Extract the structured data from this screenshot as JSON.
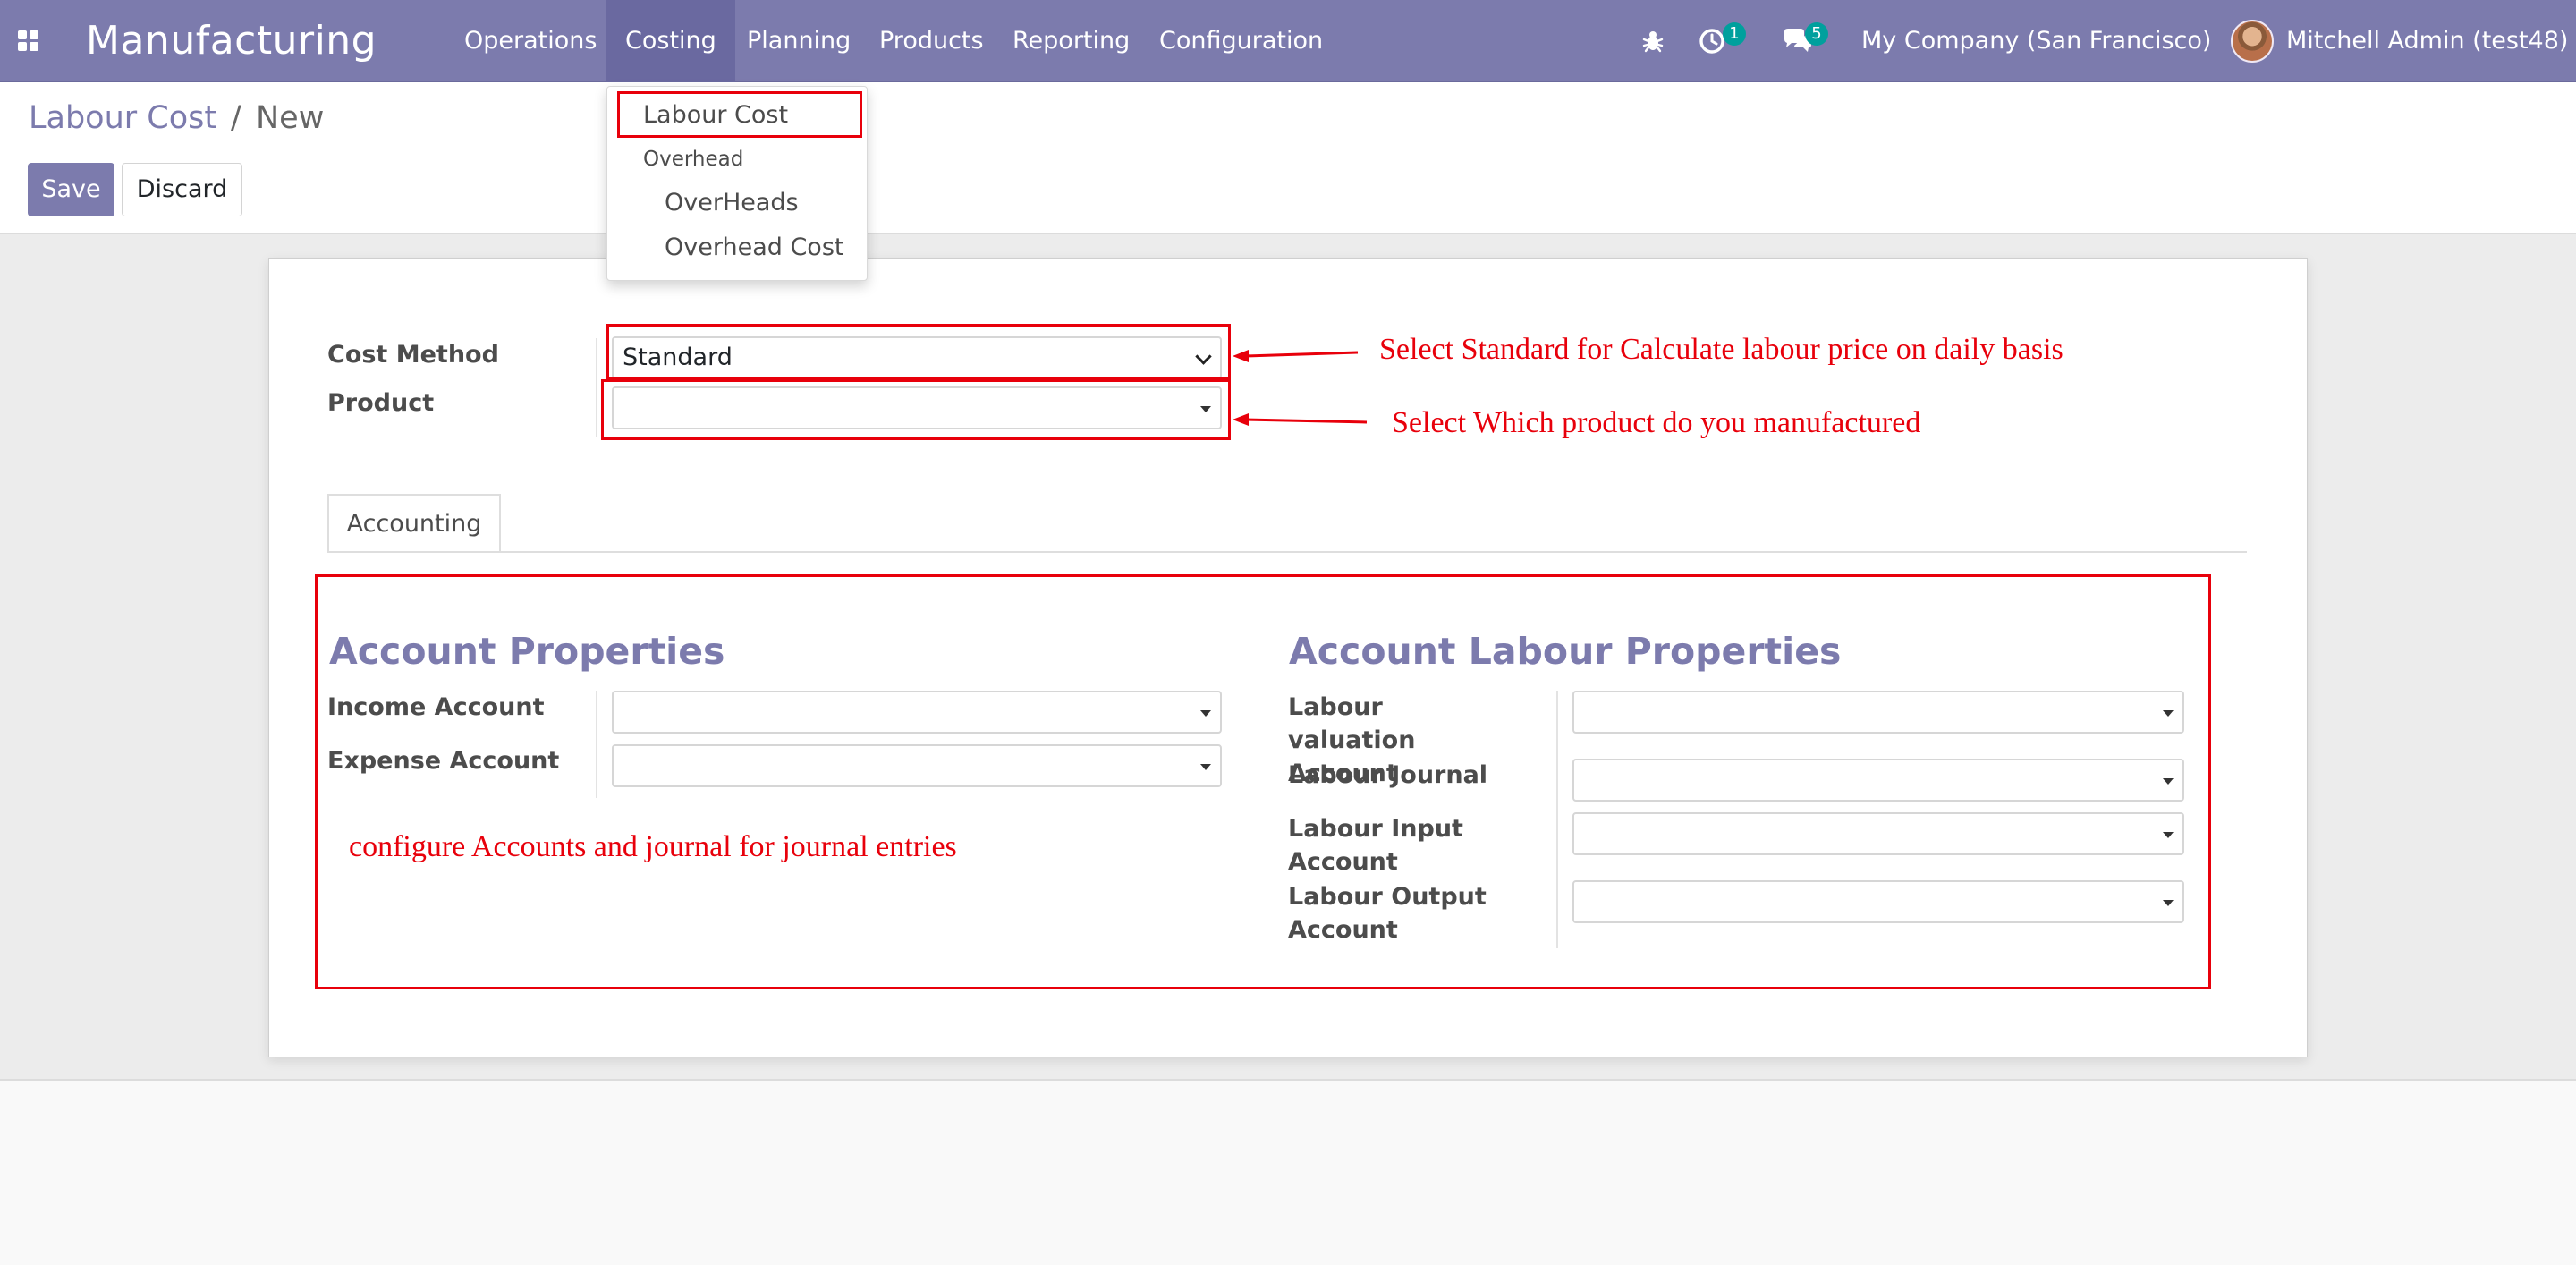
{
  "navbar": {
    "app_name": "Manufacturing",
    "menus": [
      "Operations",
      "Costing",
      "Planning",
      "Products",
      "Reporting",
      "Configuration"
    ],
    "active_menu": "Costing",
    "activity_count": "1",
    "message_count": "5",
    "company": "My Company (San Francisco)",
    "user": "Mitchell Admin (test48)"
  },
  "dropdown": {
    "items": [
      {
        "label": "Labour Cost",
        "type": "item",
        "highlighted": true
      },
      {
        "label": "Overhead",
        "type": "header"
      },
      {
        "label": "OverHeads",
        "type": "item"
      },
      {
        "label": "Overhead Cost",
        "type": "item"
      }
    ]
  },
  "breadcrumb": {
    "parent": "Labour Cost",
    "separator": "/",
    "current": "New"
  },
  "buttons": {
    "save": "Save",
    "discard": "Discard"
  },
  "form": {
    "cost_method": {
      "label": "Cost Method",
      "value": "Standard"
    },
    "product": {
      "label": "Product",
      "value": ""
    },
    "tabs": [
      "Accounting"
    ],
    "account_properties": {
      "title": "Account Properties",
      "fields": [
        {
          "label": "Income Account",
          "value": ""
        },
        {
          "label": "Expense Account",
          "value": ""
        }
      ]
    },
    "labour_properties": {
      "title": "Account Labour Properties",
      "fields": [
        {
          "label": "Labour valuation Account",
          "value": ""
        },
        {
          "label": "Labour Journal",
          "value": ""
        },
        {
          "label": "Labour Input Account",
          "value": ""
        },
        {
          "label": "Labour Output Account",
          "value": ""
        }
      ]
    }
  },
  "annotations": {
    "cost_method_note": "Select Standard for Calculate labour price on daily basis",
    "product_note": "Select Which product do you manufactured",
    "accounting_note": "configure Accounts and journal for journal entries",
    "color": "#e8000b"
  },
  "colors": {
    "brand": "#7c7bad",
    "badge": "#00a09d"
  },
  "icons": [
    "apps-grid-icon",
    "bug-icon",
    "clock-activity-icon",
    "chat-bubbles-icon"
  ]
}
